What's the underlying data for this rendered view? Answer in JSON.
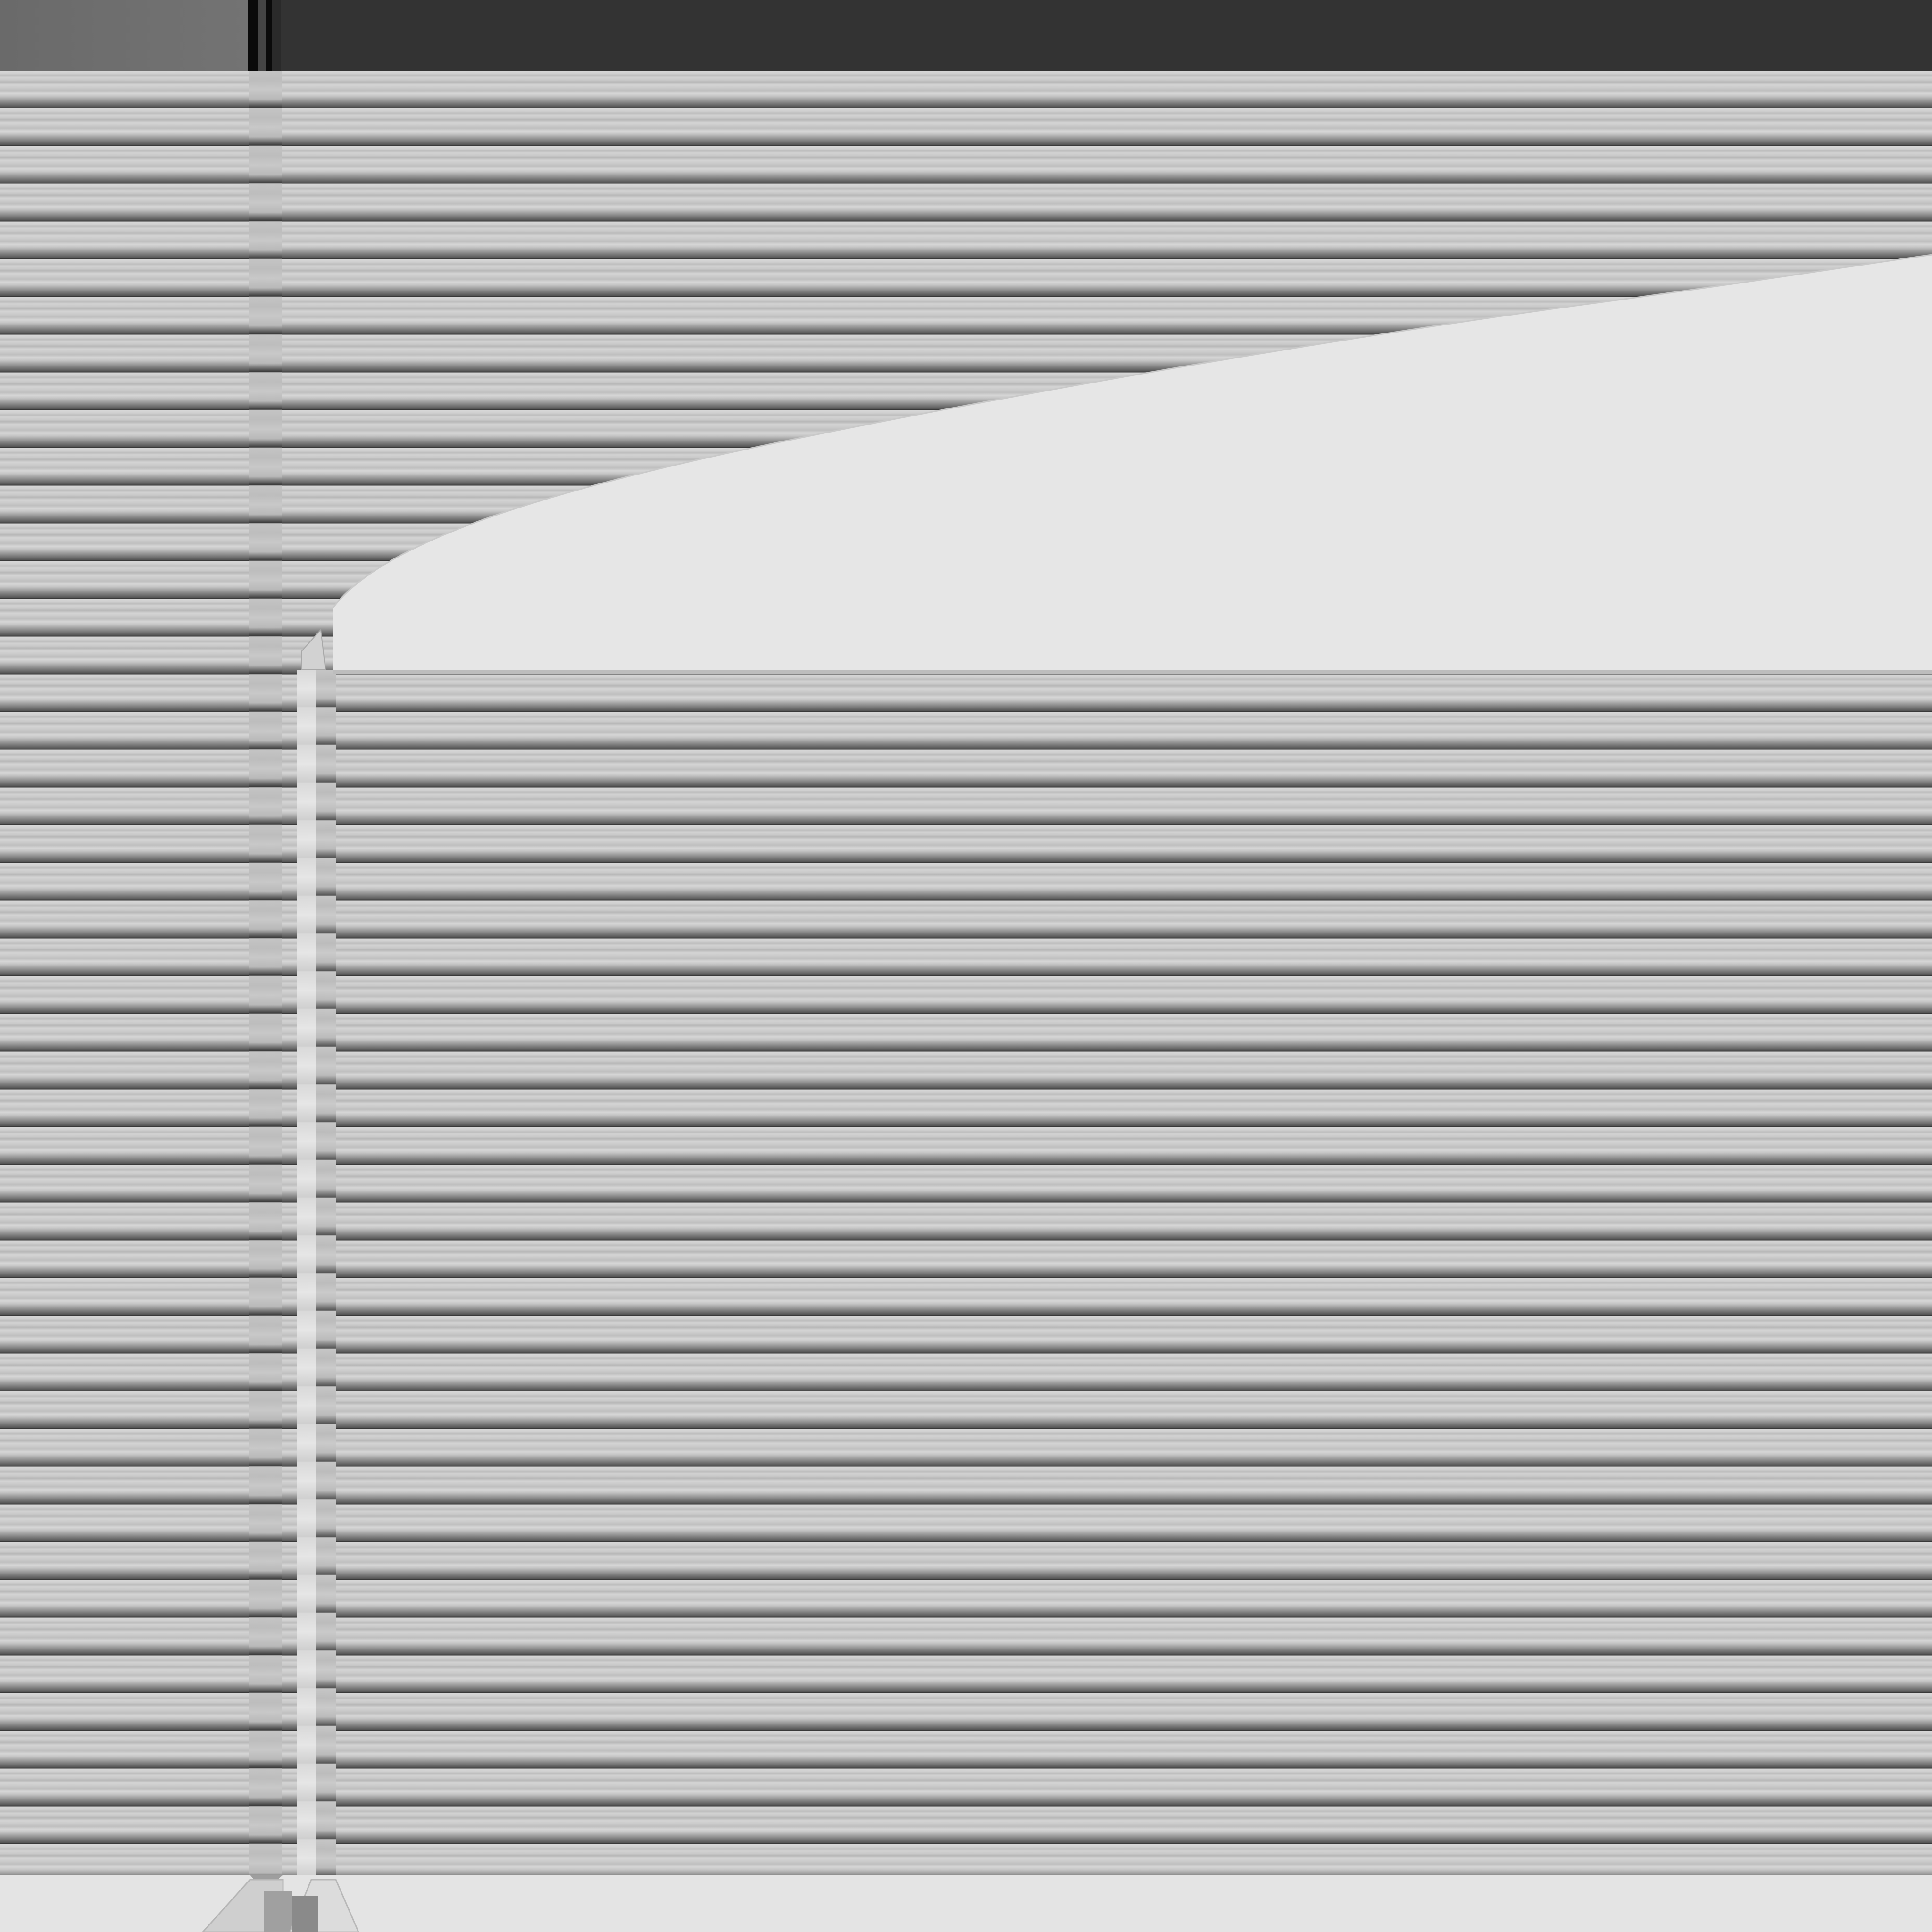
{
  "window": {
    "title": ""
  },
  "colors": {
    "titlebar": "#333333",
    "titlebar_left": "#6e6e6e",
    "content_background": "#d6d6d6",
    "highlight_region": "#e6e6e6",
    "footer": "#e4e4e4"
  },
  "content": {
    "empty_label": ""
  }
}
